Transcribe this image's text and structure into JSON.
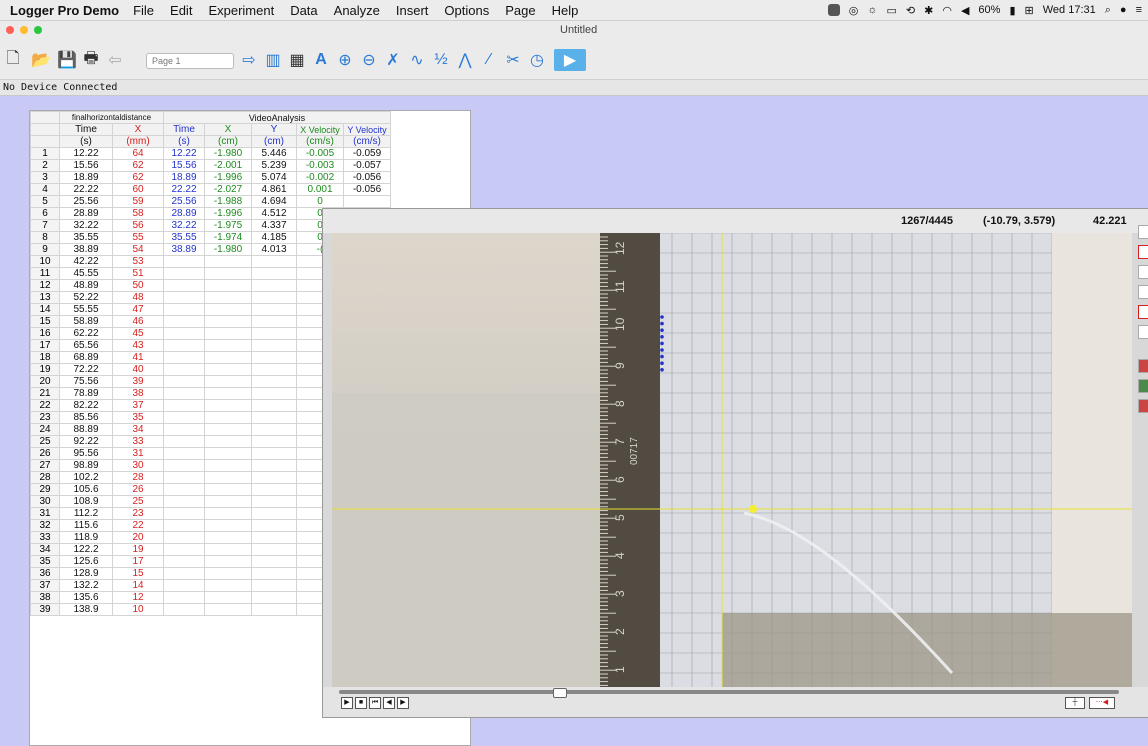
{
  "menubar": {
    "app_name": "Logger Pro Demo",
    "items": [
      "File",
      "Edit",
      "Experiment",
      "Data",
      "Analyze",
      "Insert",
      "Options",
      "Page",
      "Help"
    ],
    "battery": "60%",
    "clock": "Wed 17:31"
  },
  "window": {
    "title": "Untitled"
  },
  "toolbar": {
    "page_selector": "Page 1",
    "fraction_label": "½"
  },
  "status": {
    "device": "No Device Connected"
  },
  "table": {
    "group1": "finalhorizontaldistance",
    "group2": "VideoAnalysis",
    "columns": [
      {
        "name": "Time",
        "unit": "(s)"
      },
      {
        "name": "X",
        "unit": "(mm)"
      },
      {
        "name": "Time",
        "unit": "(s)"
      },
      {
        "name": "X",
        "unit": "(cm)"
      },
      {
        "name": "Y",
        "unit": "(cm)"
      },
      {
        "name": "X Velocity",
        "unit": "(cm/s)"
      },
      {
        "name": "Y Velocity",
        "unit": "(cm/s)"
      }
    ],
    "rows": [
      [
        "1",
        "12.22",
        "64",
        "12.22",
        "-1.980",
        "5.446",
        "-0.005",
        "-0.059"
      ],
      [
        "2",
        "15.56",
        "62",
        "15.56",
        "-2.001",
        "5.239",
        "-0.003",
        "-0.057"
      ],
      [
        "3",
        "18.89",
        "62",
        "18.89",
        "-1.996",
        "5.074",
        "-0.002",
        "-0.056"
      ],
      [
        "4",
        "22.22",
        "60",
        "22.22",
        "-2.027",
        "4.861",
        "0.001",
        "-0.056"
      ],
      [
        "5",
        "25.56",
        "59",
        "25.56",
        "-1.988",
        "4.694",
        "0",
        ""
      ],
      [
        "6",
        "28.89",
        "58",
        "28.89",
        "-1.996",
        "4.512",
        "0",
        ""
      ],
      [
        "7",
        "32.22",
        "56",
        "32.22",
        "-1.975",
        "4.337",
        "0",
        ""
      ],
      [
        "8",
        "35.55",
        "55",
        "35.55",
        "-1.974",
        "4.185",
        "0",
        ""
      ],
      [
        "9",
        "38.89",
        "54",
        "38.89",
        "-1.980",
        "4.013",
        "-(",
        ""
      ],
      [
        "10",
        "42.22",
        "53",
        "",
        "",
        "",
        "",
        ""
      ],
      [
        "11",
        "45.55",
        "51",
        "",
        "",
        "",
        "",
        ""
      ],
      [
        "12",
        "48.89",
        "50",
        "",
        "",
        "",
        "",
        ""
      ],
      [
        "13",
        "52.22",
        "48",
        "",
        "",
        "",
        "",
        ""
      ],
      [
        "14",
        "55.55",
        "47",
        "",
        "",
        "",
        "",
        ""
      ],
      [
        "15",
        "58.89",
        "46",
        "",
        "",
        "",
        "",
        ""
      ],
      [
        "16",
        "62.22",
        "45",
        "",
        "",
        "",
        "",
        ""
      ],
      [
        "17",
        "65.56",
        "43",
        "",
        "",
        "",
        "",
        ""
      ],
      [
        "18",
        "68.89",
        "41",
        "",
        "",
        "",
        "",
        ""
      ],
      [
        "19",
        "72.22",
        "40",
        "",
        "",
        "",
        "",
        ""
      ],
      [
        "20",
        "75.56",
        "39",
        "",
        "",
        "",
        "",
        ""
      ],
      [
        "21",
        "78.89",
        "38",
        "",
        "",
        "",
        "",
        ""
      ],
      [
        "22",
        "82.22",
        "37",
        "",
        "",
        "",
        "",
        ""
      ],
      [
        "23",
        "85.56",
        "35",
        "",
        "",
        "",
        "",
        ""
      ],
      [
        "24",
        "88.89",
        "34",
        "",
        "",
        "",
        "",
        ""
      ],
      [
        "25",
        "92.22",
        "33",
        "",
        "",
        "",
        "",
        ""
      ],
      [
        "26",
        "95.56",
        "31",
        "",
        "",
        "",
        "",
        ""
      ],
      [
        "27",
        "98.89",
        "30",
        "",
        "",
        "",
        "",
        ""
      ],
      [
        "28",
        "102.2",
        "28",
        "",
        "",
        "",
        "",
        ""
      ],
      [
        "29",
        "105.6",
        "26",
        "",
        "",
        "",
        "",
        ""
      ],
      [
        "30",
        "108.9",
        "25",
        "",
        "",
        "",
        "",
        ""
      ],
      [
        "31",
        "112.2",
        "23",
        "",
        "",
        "",
        "",
        ""
      ],
      [
        "32",
        "115.6",
        "22",
        "",
        "",
        "",
        "",
        ""
      ],
      [
        "33",
        "118.9",
        "20",
        "",
        "",
        "",
        "",
        ""
      ],
      [
        "34",
        "122.2",
        "19",
        "",
        "",
        "",
        "",
        ""
      ],
      [
        "35",
        "125.6",
        "17",
        "",
        "",
        "",
        "",
        ""
      ],
      [
        "36",
        "128.9",
        "15",
        "",
        "",
        "",
        "",
        ""
      ],
      [
        "37",
        "132.2",
        "14",
        "",
        "",
        "",
        "",
        ""
      ],
      [
        "38",
        "135.6",
        "12",
        "",
        "",
        "",
        "",
        ""
      ],
      [
        "39",
        "138.9",
        "10",
        "",
        "",
        "",
        "",
        ""
      ]
    ]
  },
  "video": {
    "frame_counter": "1267/4445",
    "coords": "(-10.79, 3.579)",
    "value": "42.221",
    "ruler_numbers": [
      "12",
      "11",
      "10",
      "9",
      "8",
      "7",
      "6",
      "5",
      "4",
      "3",
      "2",
      "1"
    ],
    "ruler_text": "00717"
  },
  "colors": {
    "accent_red": "#d62020",
    "accent_blue": "#2233cc",
    "accent_green": "#1e8a1e",
    "track_yellow": "#e8e230"
  }
}
